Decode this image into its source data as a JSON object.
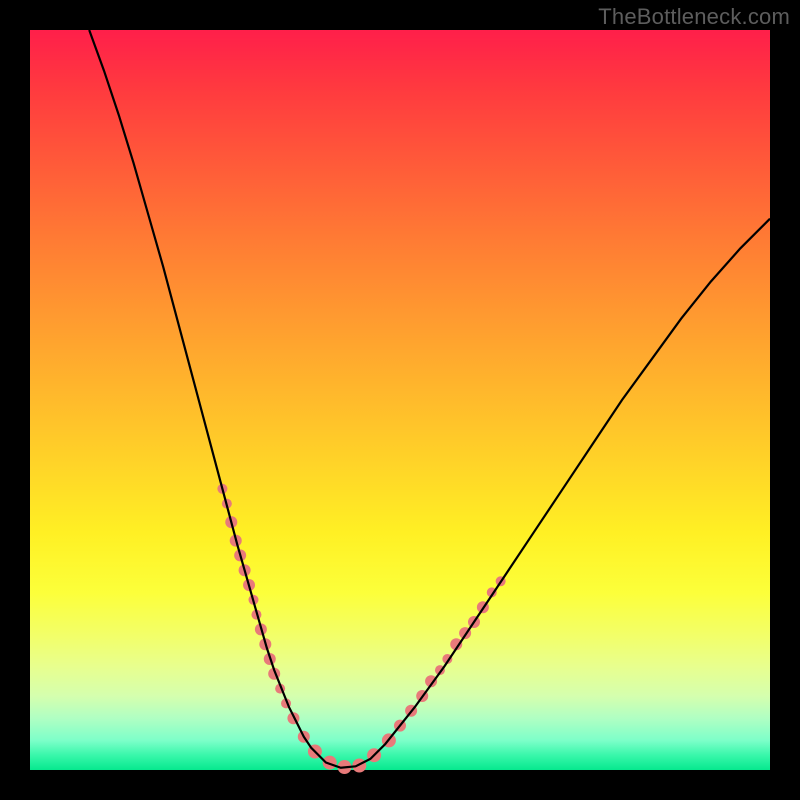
{
  "watermark_text": "TheBottleneck.com",
  "chart_data": {
    "type": "line",
    "title": "",
    "xlabel": "",
    "ylabel": "",
    "xlim": [
      0,
      100
    ],
    "ylim": [
      0,
      100
    ],
    "series": [
      {
        "name": "curve",
        "color": "#000000",
        "x": [
          8,
          10,
          12,
          14,
          16,
          18,
          20,
          22,
          24,
          26,
          28,
          29,
          30,
          31,
          32,
          33,
          34,
          35,
          36,
          37,
          38,
          40,
          42,
          44,
          46,
          48,
          52,
          56,
          60,
          64,
          68,
          72,
          76,
          80,
          84,
          88,
          92,
          96,
          100
        ],
        "values": [
          100,
          94.5,
          88.5,
          82,
          75,
          68,
          60.5,
          53,
          45.5,
          38,
          30.5,
          27,
          23.5,
          20,
          16.5,
          13.5,
          11,
          8.5,
          6.5,
          4.5,
          3,
          1,
          0.3,
          0.5,
          1.5,
          3.5,
          8.5,
          14,
          20,
          26,
          32,
          38,
          44,
          50,
          55.5,
          61,
          66,
          70.5,
          74.5
        ]
      }
    ],
    "highlight_points": {
      "name": "highlight-dots",
      "color": "#e87a7a",
      "radius_range": [
        4,
        8
      ],
      "points": [
        {
          "x": 26.0,
          "y": 38.0,
          "r": 5
        },
        {
          "x": 26.6,
          "y": 36.0,
          "r": 5
        },
        {
          "x": 27.2,
          "y": 33.5,
          "r": 6
        },
        {
          "x": 27.8,
          "y": 31.0,
          "r": 6
        },
        {
          "x": 28.4,
          "y": 29.0,
          "r": 6
        },
        {
          "x": 29.0,
          "y": 27.0,
          "r": 6
        },
        {
          "x": 29.6,
          "y": 25.0,
          "r": 6
        },
        {
          "x": 30.2,
          "y": 23.0,
          "r": 5
        },
        {
          "x": 30.6,
          "y": 21.0,
          "r": 5
        },
        {
          "x": 31.2,
          "y": 19.0,
          "r": 6
        },
        {
          "x": 31.8,
          "y": 17.0,
          "r": 6
        },
        {
          "x": 32.4,
          "y": 15.0,
          "r": 6
        },
        {
          "x": 33.0,
          "y": 13.0,
          "r": 6
        },
        {
          "x": 33.8,
          "y": 11.0,
          "r": 5
        },
        {
          "x": 34.6,
          "y": 9.0,
          "r": 5
        },
        {
          "x": 35.6,
          "y": 7.0,
          "r": 6
        },
        {
          "x": 37.0,
          "y": 4.5,
          "r": 6
        },
        {
          "x": 38.5,
          "y": 2.5,
          "r": 7
        },
        {
          "x": 40.5,
          "y": 1.0,
          "r": 7
        },
        {
          "x": 42.5,
          "y": 0.4,
          "r": 7
        },
        {
          "x": 44.5,
          "y": 0.6,
          "r": 7
        },
        {
          "x": 46.5,
          "y": 2.0,
          "r": 7
        },
        {
          "x": 48.5,
          "y": 4.0,
          "r": 7
        },
        {
          "x": 50.0,
          "y": 6.0,
          "r": 6
        },
        {
          "x": 51.5,
          "y": 8.0,
          "r": 6
        },
        {
          "x": 53.0,
          "y": 10.0,
          "r": 6
        },
        {
          "x": 54.2,
          "y": 12.0,
          "r": 6
        },
        {
          "x": 55.4,
          "y": 13.5,
          "r": 5
        },
        {
          "x": 56.4,
          "y": 15.0,
          "r": 5
        },
        {
          "x": 57.6,
          "y": 17.0,
          "r": 6
        },
        {
          "x": 58.8,
          "y": 18.5,
          "r": 6
        },
        {
          "x": 60.0,
          "y": 20.0,
          "r": 6
        },
        {
          "x": 61.2,
          "y": 22.0,
          "r": 6
        },
        {
          "x": 62.4,
          "y": 24.0,
          "r": 5
        },
        {
          "x": 63.6,
          "y": 25.5,
          "r": 5
        }
      ]
    },
    "background_gradient": {
      "top": "#ff1f4a",
      "mid": "#ffe029",
      "bottom": "#06e98e"
    }
  }
}
